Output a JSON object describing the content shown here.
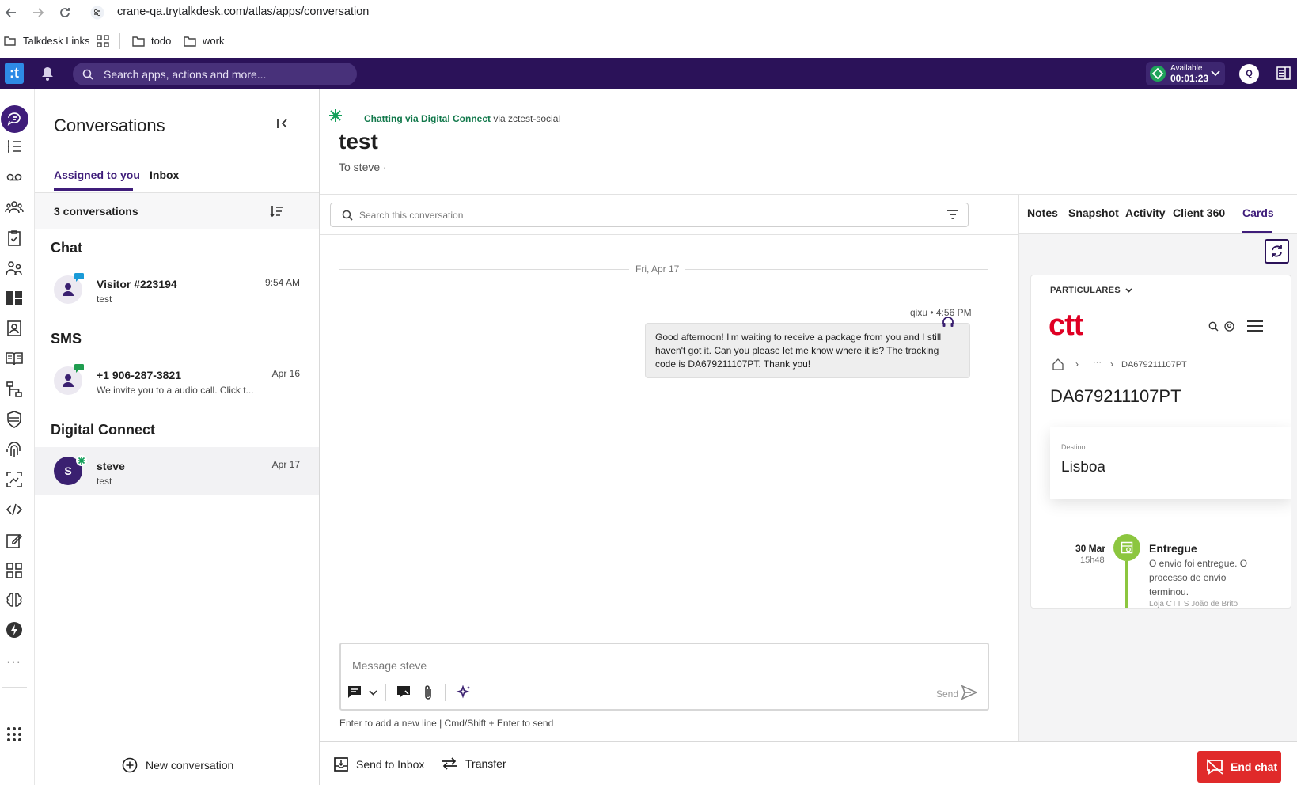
{
  "browser": {
    "url": "crane-qa.trytalkdesk.com/atlas/apps/conversation",
    "bookmarks": [
      {
        "label": "Talkdesk Links"
      },
      {
        "label": "todo"
      },
      {
        "label": "work"
      }
    ]
  },
  "topbar": {
    "logo": ":t",
    "search_placeholder": "Search apps, actions and more...",
    "status_label": "Available",
    "status_timer": "00:01:23",
    "avatar_initial": "Q"
  },
  "conversations": {
    "title": "Conversations",
    "tabs": [
      {
        "label": "Assigned to you",
        "active": true
      },
      {
        "label": "Inbox",
        "active": false
      }
    ],
    "count_label": "3 conversations",
    "sections": [
      {
        "title": "Chat",
        "items": [
          {
            "name": "Visitor #223194",
            "preview": "test",
            "time": "9:54 AM"
          }
        ]
      },
      {
        "title": "SMS",
        "items": [
          {
            "name": "+1 906-287-3821",
            "preview": "We invite you to a audio call. Click t...",
            "time": "Apr 16"
          }
        ]
      },
      {
        "title": "Digital Connect",
        "items": [
          {
            "name": "steve",
            "preview": "test",
            "time": "Apr 17",
            "avatar_initial": "S",
            "selected": true
          }
        ]
      }
    ],
    "new_conversation_label": "New conversation"
  },
  "chat": {
    "channel_bold": "Chatting via Digital Connect",
    "channel_via": "via zctest-social",
    "title": "test",
    "to_line": "To steve ·",
    "search_placeholder": "Search this conversation",
    "date_separator": "Fri, Apr 17",
    "message": {
      "meta": "qixu • 4:56 PM",
      "text": "Good afternoon! I'm waiting to receive a package from you and I still haven't got it. Can you please let me know where it is? The tracking code is DA679211107PT. Thank you!"
    },
    "composer_placeholder": "Message steve",
    "send_label": "Send",
    "hint": "Enter to add a new line | Cmd/Shift + Enter to send"
  },
  "side_panel": {
    "tabs": [
      {
        "label": "Notes",
        "active": false
      },
      {
        "label": "Snapshot",
        "active": false
      },
      {
        "label": "Activity",
        "active": false
      },
      {
        "label": "Client 360",
        "active": false
      },
      {
        "label": "Cards",
        "active": true
      }
    ],
    "card": {
      "menu_label": "PARTICULARES",
      "brand": "ctt",
      "breadcrumb_ellipsis": "···",
      "breadcrumb_code": "DA679211107PT",
      "tracking_code": "DA679211107PT",
      "destination_label": "Destino",
      "destination_value": "Lisboa",
      "timeline": {
        "date": "30 Mar",
        "time": "15h48",
        "title": "Entregue",
        "description": "O envio foi entregue. O processo de envio terminou.",
        "location": "Loja CTT S João de Brito"
      }
    }
  },
  "actions": {
    "send_to_inbox": "Send to Inbox",
    "transfer": "Transfer",
    "end_chat": "End chat"
  },
  "colors": {
    "topbar": "#2b1259",
    "accent": "#3f1d7a",
    "status_green": "#1fa35a",
    "end_chat_red": "#e02a2a",
    "ctt_red": "#df0024",
    "timeline_green": "#8cc63f"
  }
}
